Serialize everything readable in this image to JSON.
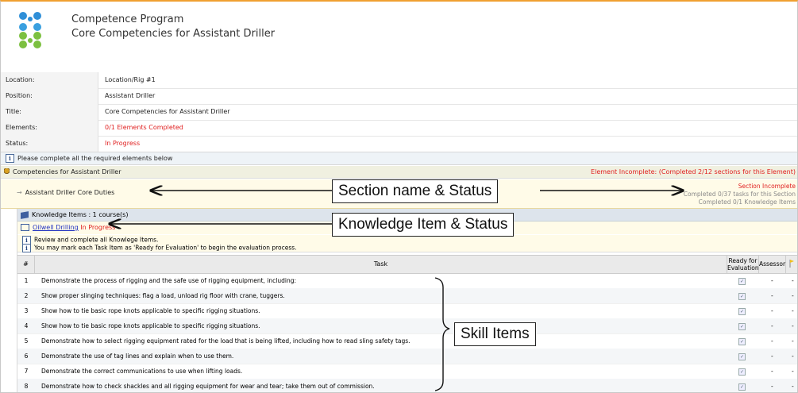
{
  "header": {
    "title": "Competence Program",
    "subtitle": "Core Competencies for Assistant Driller"
  },
  "info": [
    {
      "label": "Location:",
      "value": "Location/Rig #1"
    },
    {
      "label": "Position:",
      "value": "Assistant Driller"
    },
    {
      "label": "Title:",
      "value": "Core Competencies for Assistant Driller"
    },
    {
      "label": "Elements:",
      "value": "0/1 Elements Completed"
    },
    {
      "label": "Status:",
      "value": "In Progress"
    }
  ],
  "please_text": "Please complete all the required elements below",
  "competency": {
    "title": "Competencies for Assistant Driller",
    "status": "Element Incomplete: (Completed 2/12 sections for this Element)"
  },
  "section": {
    "name": "Assistant Driller Core Duties",
    "status_title": "Section Incomplete",
    "status_line1": "Completed 0/37 tasks for this Section",
    "status_line2": "Completed 0/1 Knowledge Items"
  },
  "knowledge": {
    "label": "Knowledge Items : 1 course(s)",
    "course_link": "Oilwell Drilling",
    "course_status": "In Progress",
    "review_line1": "Review and complete all Knowlege Items.",
    "review_line2": "You may mark each Task Item as 'Ready for Evaluation' to begin the evaluation process."
  },
  "table": {
    "col_num": "#",
    "col_task": "Task",
    "col_ready": "Ready for Evaluation",
    "col_assessor": "Assessor",
    "rows": [
      {
        "num": "1",
        "task": "Demonstrate the process of rigging and the safe use of rigging equipment, including:",
        "assessor": "-",
        "extra": "-"
      },
      {
        "num": "2",
        "task": "Show proper slinging techniques: flag a load, unload rig floor with crane, tuggers.",
        "assessor": "-",
        "extra": "-"
      },
      {
        "num": "3",
        "task": "Show how to tie basic rope knots applicable to specific rigging situations.",
        "assessor": "-",
        "extra": "-"
      },
      {
        "num": "4",
        "task": "Show how to tie basic rope knots applicable to specific rigging situations.",
        "assessor": "-",
        "extra": "-"
      },
      {
        "num": "5",
        "task": "Demonstrate how to select rigging equipment rated for the load that is being lifted, including how to read sling safety tags.",
        "assessor": "-",
        "extra": "-"
      },
      {
        "num": "6",
        "task": "Demonstrate the use of tag lines and explain when to use them.",
        "assessor": "-",
        "extra": "-"
      },
      {
        "num": "7",
        "task": "Demonstrate the correct communications to use when lifting loads.",
        "assessor": "-",
        "extra": "-"
      },
      {
        "num": "8",
        "task": "Demonstrate how to check shackles and all rigging equipment for wear and tear; take them out of commission.",
        "assessor": "-",
        "extra": "-"
      }
    ]
  },
  "annotations": {
    "section": "Section name & Status",
    "knowledge": "Knowledge Item & Status",
    "skill": "Skill Items"
  },
  "colors": {
    "accent_red": "#e02020",
    "link_blue": "#2030c0",
    "top_border": "#f0a030"
  }
}
